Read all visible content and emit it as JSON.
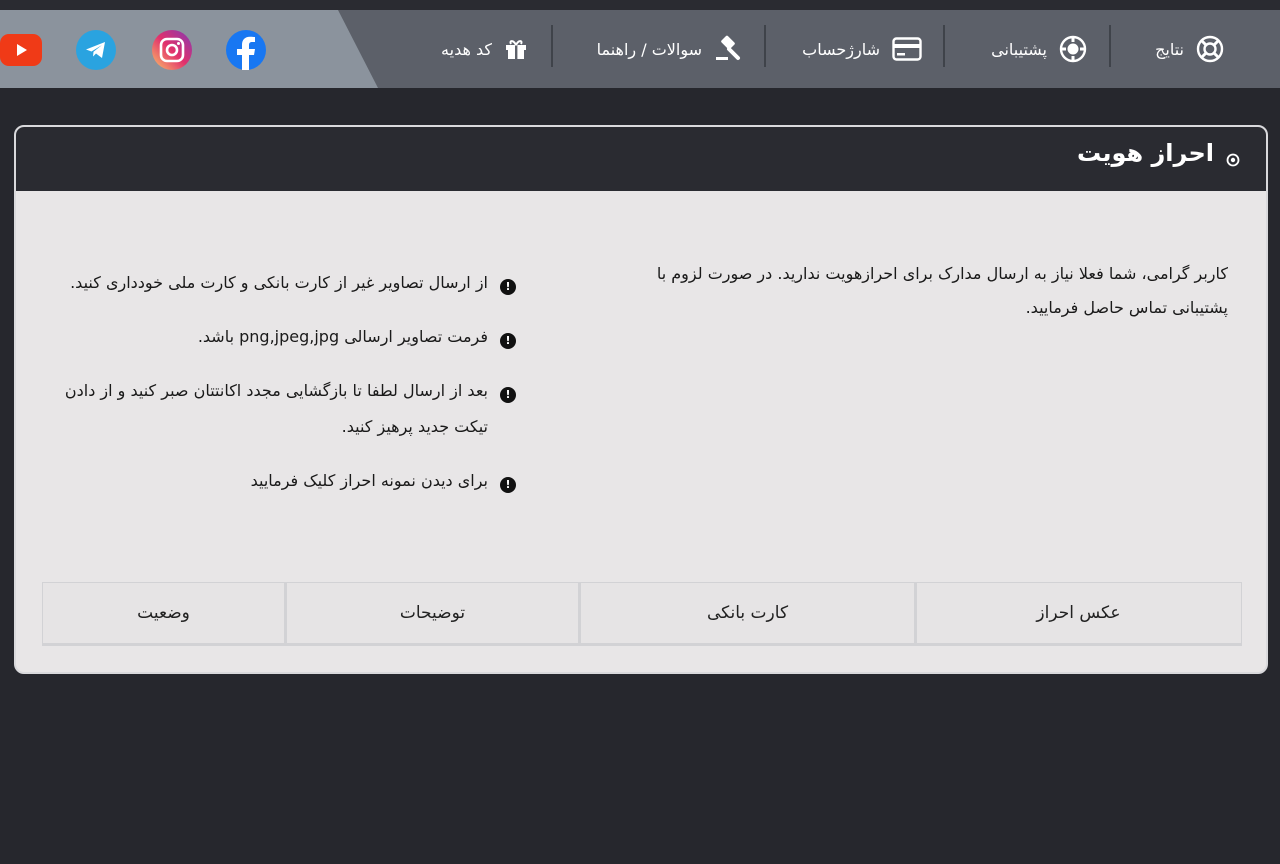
{
  "nav": {
    "items": [
      {
        "label": "نتایج",
        "icon": "lifebuoy-icon"
      },
      {
        "label": "پشتیبانی",
        "icon": "support-ball-icon"
      },
      {
        "label": "شارژحساب",
        "icon": "credit-card-icon"
      },
      {
        "label": "سوالات / راهنما",
        "icon": "gavel-icon"
      },
      {
        "label": "کد هدیه",
        "icon": "gift-icon"
      }
    ],
    "social": [
      "facebook-icon",
      "instagram-icon",
      "telegram-icon",
      "youtube-icon"
    ]
  },
  "card": {
    "title": "احراز هویت",
    "intro": "کاربر گرامی، شما فعلا نیاز به ارسال مدارک برای احرازهویت ندارید. در صورت لزوم با پشتیبانی تماس حاصل فرمایید.",
    "notes": [
      "از ارسال تصاویر غیر از کارت بانکی و کارت ملی خودداری کنید.",
      "فرمت تصاویر ارسالی png,jpeg,jpg باشد.",
      "بعد از ارسال لطفا تا بازگشایی مجدد اکانتتان صبر کنید و از دادن تیکت جدید پرهیز کنید.",
      "برای دیدن نمونه احراز کلیک فرمایید"
    ],
    "table_headers": [
      "عکس احراز",
      "کارت بانکی",
      "توضیحات",
      "وضعیت"
    ]
  },
  "colors": {
    "background": "#26272d",
    "navbar": "#5c6069",
    "social_panel": "#8b939d",
    "card_header": "#2a2b31",
    "card_body": "#e8e6e7"
  }
}
